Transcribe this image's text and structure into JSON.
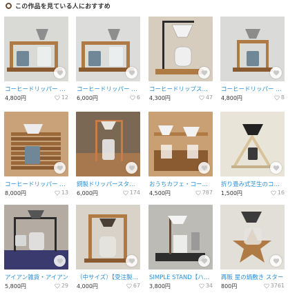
{
  "section": {
    "title": "この作品を見ている人におすすめ"
  },
  "products": [
    {
      "name": "コーヒードリッパー スタンド",
      "price": "4,800円",
      "likes": "12",
      "bg": "#d9d9d6",
      "scene": "stand-double"
    },
    {
      "name": "コーヒードリッパー スタンド",
      "price": "6,000円",
      "likes": "6",
      "bg": "#dcdcda",
      "scene": "stand-double"
    },
    {
      "name": "コーヒードリップスタンド",
      "price": "4,300円",
      "likes": "47",
      "bg": "#d6cdbf",
      "scene": "iron-server"
    },
    {
      "name": "コーヒードリッパー スタンド",
      "price": "4,800円",
      "likes": "8",
      "bg": "#dadad8",
      "scene": "stand-single"
    },
    {
      "name": "コーヒードリッパー スタンド",
      "price": "8,000円",
      "likes": "13",
      "bg": "#caa27a",
      "scene": "stacked-wood"
    },
    {
      "name": "銅製ドリッパースタンド",
      "price": "6,000円",
      "likes": "174",
      "bg": "#7a6754",
      "scene": "copper"
    },
    {
      "name": "おうちカフェ・コーヒー",
      "price": "4,500円",
      "likes": "787",
      "bg": "#c8a074",
      "scene": "cafe"
    },
    {
      "name": "折り畳み式芝生のコーヒー",
      "price": "1,500円",
      "likes": "16",
      "bg": "#e8e4d8",
      "scene": "folding"
    },
    {
      "name": "アイアン雑貨・アイアン",
      "price": "5,800円",
      "likes": "29",
      "bg": "#b4aca3",
      "scene": "iron-frame"
    },
    {
      "name": "（中サイズ）【受注製作】",
      "price": "4,000円",
      "likes": "67",
      "bg": "#d8d2c8",
      "scene": "wood-frame"
    },
    {
      "name": "SIMPLE STAND【ハンド】",
      "price": "3,800円",
      "likes": "34",
      "bg": "#bdbbb6",
      "scene": "simple"
    },
    {
      "name": "再販 星の鍋敷き スター",
      "price": "800円",
      "likes": "3761",
      "bg": "#e2dfd8",
      "scene": "star"
    }
  ],
  "colors": {
    "link": "#2a8fd6",
    "heart": "#c9c9c9",
    "accent": "#6b4a2f"
  },
  "icons": {
    "favorite": "heart-icon",
    "likes": "heart-outline-icon",
    "section": "ring-icon"
  }
}
